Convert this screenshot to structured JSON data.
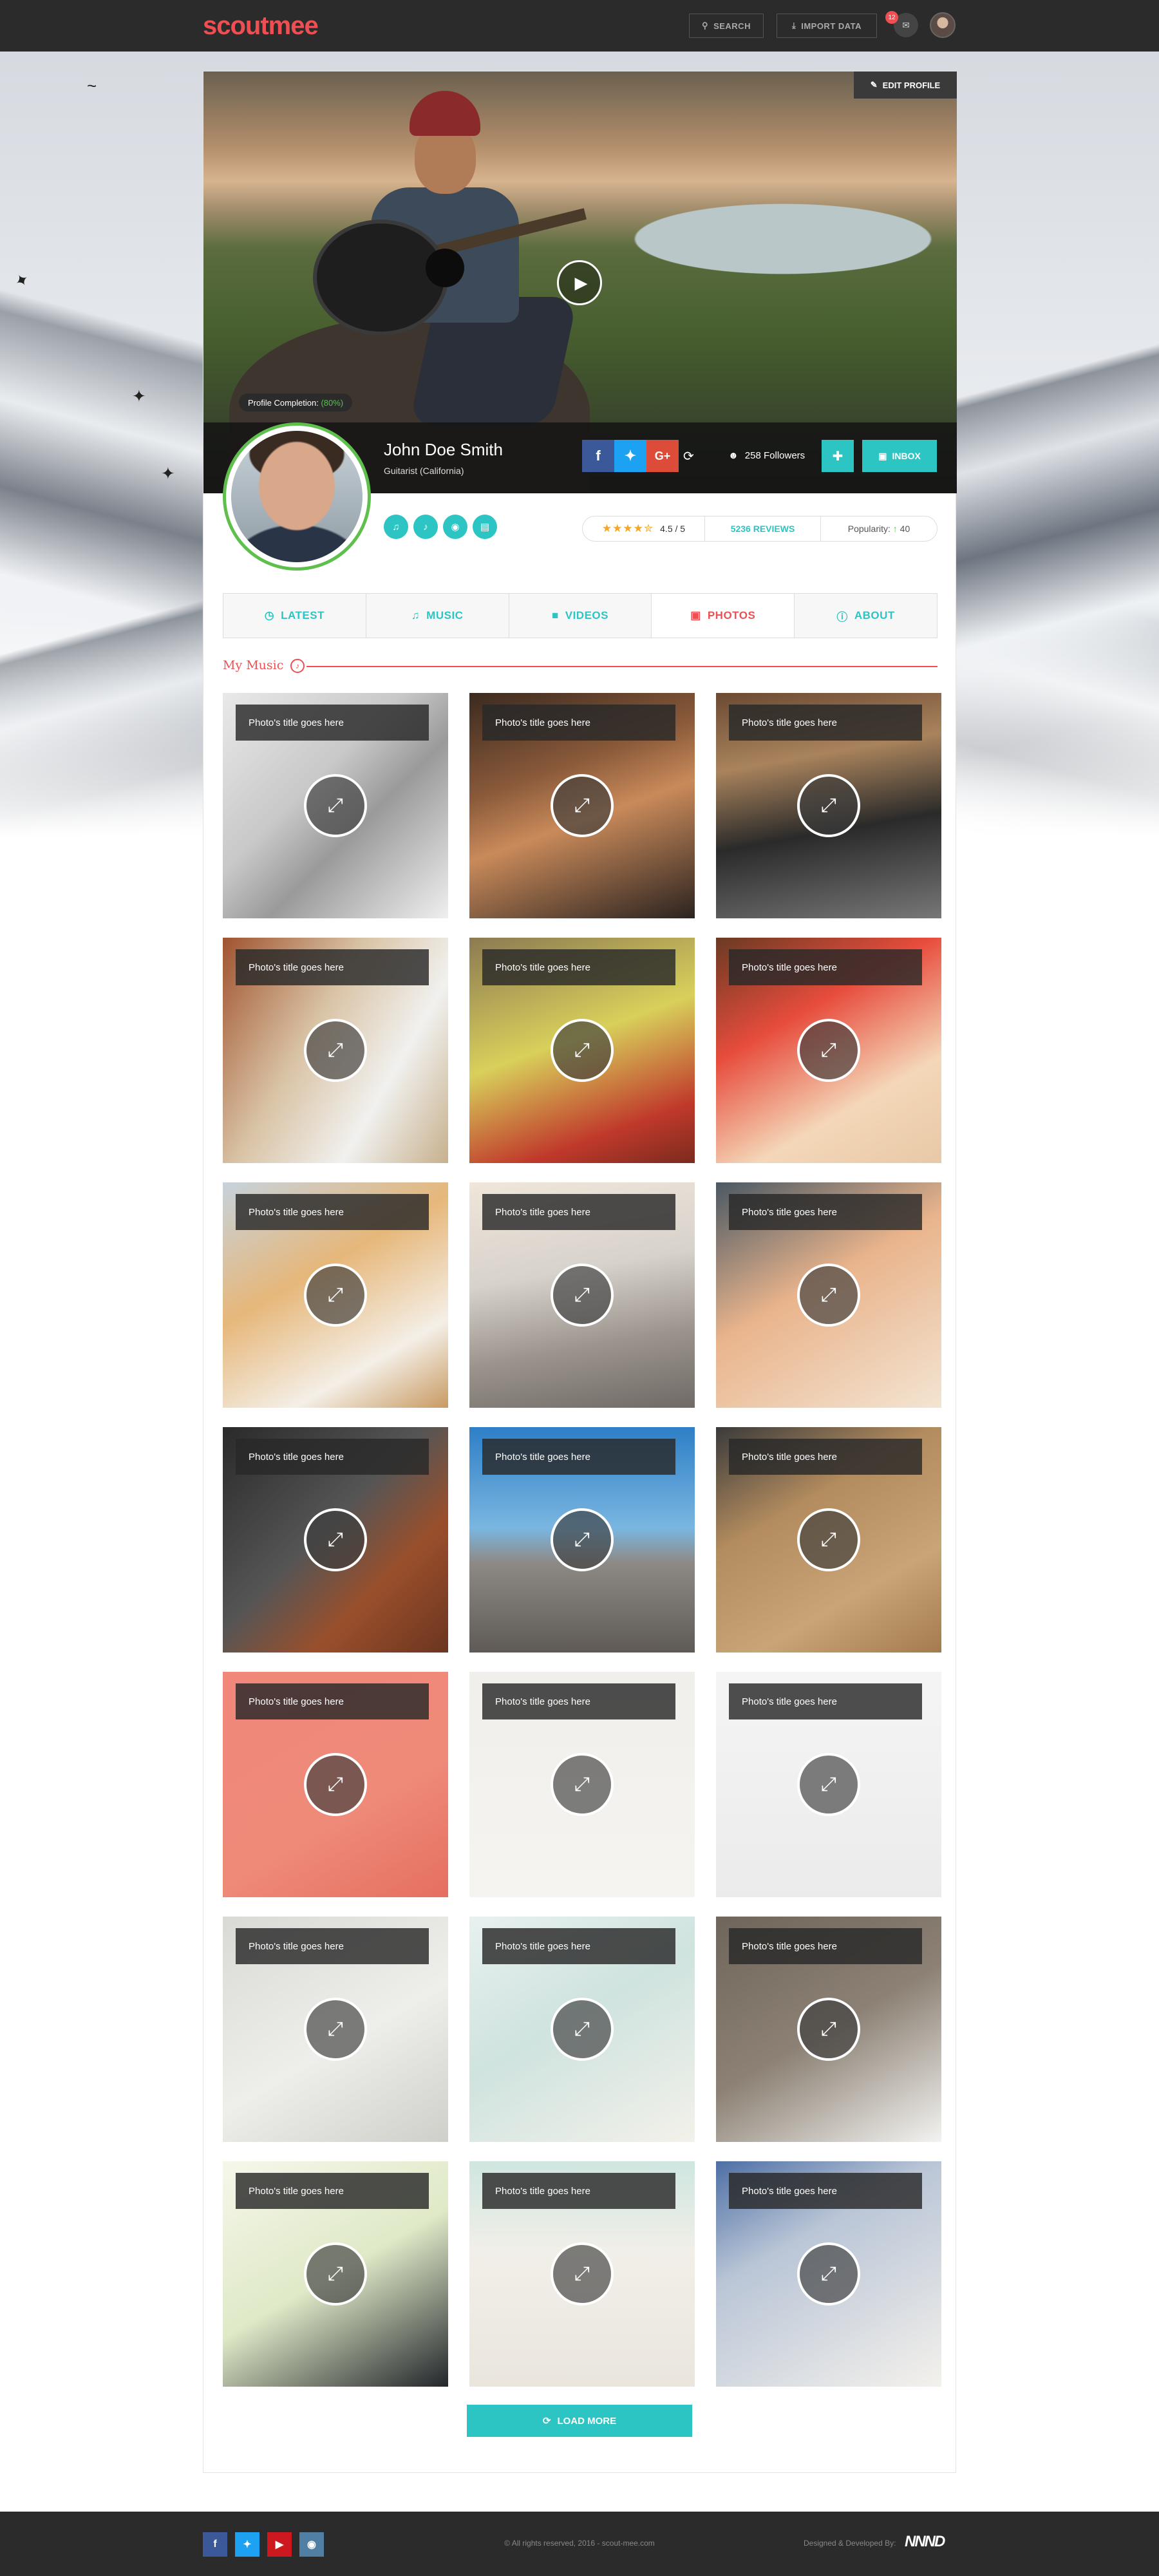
{
  "header": {
    "logo": "scoutmee",
    "search_label": "SEARCH",
    "import_label": "IMPORT DATA",
    "notification_count": "12"
  },
  "profile": {
    "edit_label": "EDIT PROFILE",
    "completion_label": "Profile Completion:",
    "completion_value": "(80%)",
    "name": "John Doe Smith",
    "role": "Guitarist (California)",
    "followers": "258 Followers",
    "inbox_label": "INBOX",
    "rating": "4.5 / 5",
    "rating_value": 4.5,
    "reviews": "5236 REVIEWS",
    "popularity_label": "Popularity:",
    "popularity_value": "40",
    "socials": [
      "facebook",
      "twitter",
      "google-plus"
    ],
    "quick_icons": [
      "headphones-icon",
      "music-icon",
      "android-icon",
      "ticket-icon"
    ]
  },
  "tabs": [
    {
      "label": "LATEST",
      "icon": "clock-icon"
    },
    {
      "label": "MUSIC",
      "icon": "music-icon"
    },
    {
      "label": "VIDEOS",
      "icon": "video-icon"
    },
    {
      "label": "PHOTOS",
      "icon": "image-icon",
      "active": true
    },
    {
      "label": "ABOUT",
      "icon": "info-icon"
    }
  ],
  "section": {
    "title": "My Music"
  },
  "photos": [
    {
      "title": "Photo's title goes here"
    },
    {
      "title": "Photo's title goes here"
    },
    {
      "title": "Photo's title goes here"
    },
    {
      "title": "Photo's title goes here"
    },
    {
      "title": "Photo's title goes here"
    },
    {
      "title": "Photo's title goes here"
    },
    {
      "title": "Photo's title goes here"
    },
    {
      "title": "Photo's title goes here"
    },
    {
      "title": "Photo's title goes here"
    },
    {
      "title": "Photo's title goes here"
    },
    {
      "title": "Photo's title goes here"
    },
    {
      "title": "Photo's title goes here"
    },
    {
      "title": "Photo's title goes here"
    },
    {
      "title": "Photo's title goes here"
    },
    {
      "title": "Photo's title goes here"
    },
    {
      "title": "Photo's title goes here"
    },
    {
      "title": "Photo's title goes here"
    },
    {
      "title": "Photo's title goes here"
    },
    {
      "title": "Photo's title goes here"
    },
    {
      "title": "Photo's title goes here"
    },
    {
      "title": "Photo's title goes here"
    }
  ],
  "load_more": "LOAD MORE",
  "footer": {
    "copyright": "© All rights reserved, 2016 - scout-mee.com",
    "designed": "Designed & Developed By:",
    "brand": "NNND",
    "socials": [
      "facebook",
      "twitter",
      "youtube",
      "instagram"
    ]
  },
  "colors": {
    "accent": "#ee4f53",
    "teal": "#2dc4c4",
    "green": "#58c24b",
    "dark": "#2b2b2b"
  }
}
